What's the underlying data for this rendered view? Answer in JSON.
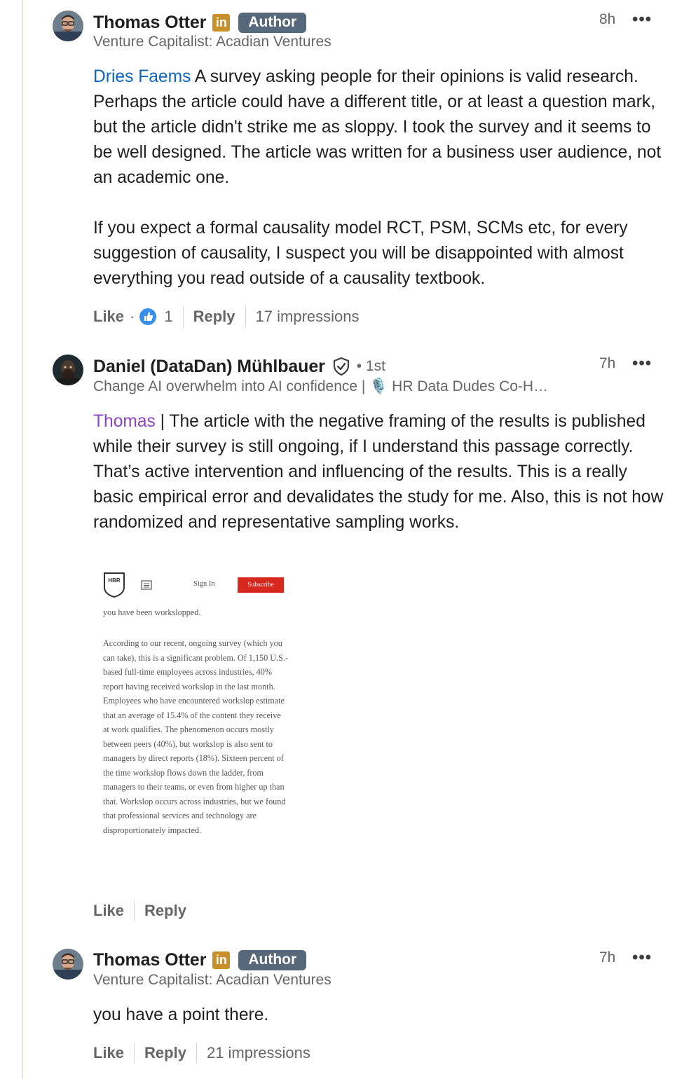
{
  "comments": [
    {
      "author": "Thomas Otter",
      "linkedin_badge": "in",
      "role_badge": "Author",
      "headline": "Venture Capitalist: Acadian Ventures",
      "time": "8h",
      "more": "•••",
      "mention": "Dries Faems",
      "paragraph1": " A survey asking people for their opinions is valid research. Perhaps the article could have a different title, or at least a question mark, but the article didn't strike me as sloppy. I took the survey and it seems to be well designed. The article was written for a business user audience, not an academic one.",
      "paragraph2": "If you expect a formal causality model RCT, PSM, SCMs etc, for every suggestion of causality, I suspect you will be disappointed with almost everything you read outside of a causality textbook.",
      "like_label": "Like",
      "dot": "·",
      "reaction_count": "1",
      "reply_label": "Reply",
      "impressions": "17 impressions"
    },
    {
      "author": "Daniel (DataDan) Mühlbauer",
      "degree": "• 1st",
      "headline": "Change AI overwhelm into AI confidence | 🎙️ HR Data Dudes Co-H…",
      "time": "7h",
      "more": "•••",
      "mention": "Thomas",
      "paragraph1": " | The article with the negative framing of the results is published while their survey is still ongoing, if I understand this passage correctly. That’s active intervention and influencing of the results. This is a really basic empirical error and devalidates the study for me. Also, this is not how randomized and representative sampling works.",
      "attachment": {
        "logo": "HBR",
        "sign_in": "Sign In",
        "subscribe": "Subscribe",
        "lead_line": "you have been workslopped.",
        "body": "According to our recent, ongoing survey (which you can take), this is a significant problem. Of 1,150 U.S.-based full-time employees across industries, 40% report having received workslop in the last month. Employees who have encountered workslop estimate that an average of 15.4% of the content they receive at work qualifies. The phenomenon occurs mostly between peers (40%), but workslop is also sent to managers by direct reports (18%). Sixteen percent of the time workslop flows down the ladder, from managers to their teams, or even from higher up than that. Workslop occurs across industries, but we found that professional services and technology are disproportionately impacted."
      },
      "like_label": "Like",
      "reply_label": "Reply"
    },
    {
      "author": "Thomas Otter",
      "linkedin_badge": "in",
      "role_badge": "Author",
      "headline": "Venture Capitalist: Acadian Ventures",
      "time": "7h",
      "more": "•••",
      "paragraph1": "you have a point there.",
      "like_label": "Like",
      "reply_label": "Reply",
      "impressions": "21 impressions"
    }
  ],
  "colors": {
    "mention_blue": "#0a66c2",
    "mention_purple": "#8a44c0",
    "author_badge": "#56687a",
    "linkedin_badge": "#c8902b",
    "subscribe_red": "#d6281c"
  }
}
